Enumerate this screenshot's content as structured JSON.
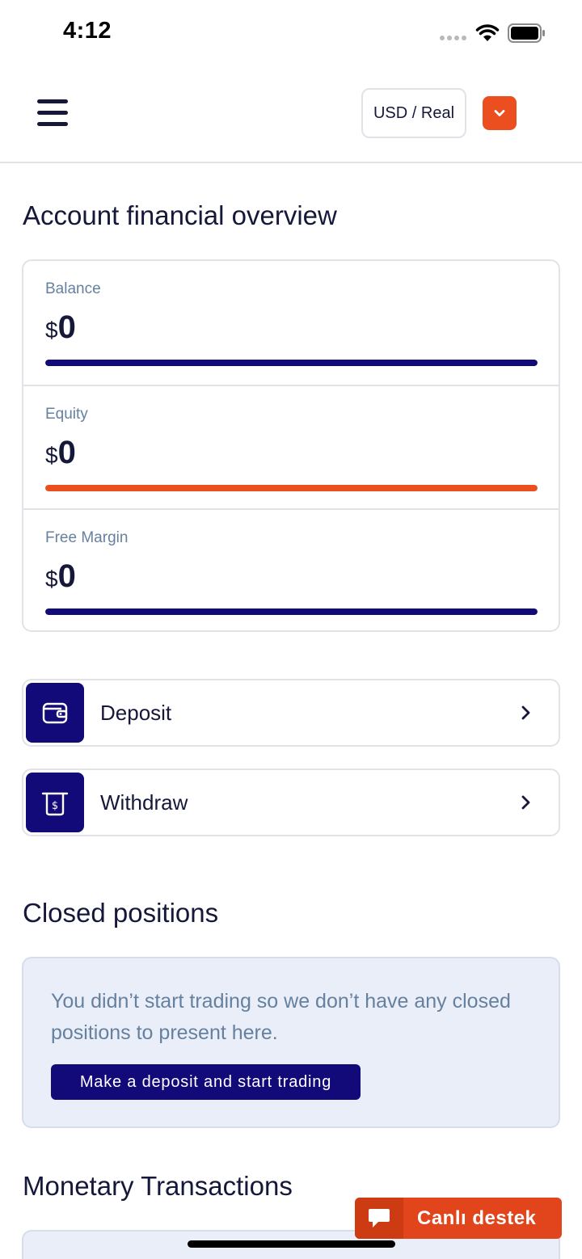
{
  "status_bar": {
    "time": "4:12"
  },
  "header": {
    "account_label": "USD / Real"
  },
  "overview": {
    "title": "Account financial overview",
    "currency_symbol": "$",
    "metrics": [
      {
        "label": "Balance",
        "value": "0",
        "bar_color": "#120a78",
        "fill_fraction": 1.0
      },
      {
        "label": "Equity",
        "value": "0",
        "bar_color": "#eb4f1f",
        "fill_fraction": 1.0
      },
      {
        "label": "Free Margin",
        "value": "0",
        "bar_color": "#120a78",
        "fill_fraction": 1.0
      }
    ]
  },
  "actions": [
    {
      "label": "Deposit",
      "icon": "wallet-icon"
    },
    {
      "label": "Withdraw",
      "icon": "cash-withdraw-icon"
    }
  ],
  "closed_positions": {
    "title": "Closed positions",
    "empty_message": "You didn’t start trading so we don’t have any closed positions to present here.",
    "cta_label": "Make a deposit and start trading"
  },
  "monetary_transactions": {
    "title": "Monetary Transactions"
  },
  "support": {
    "label": "Canlı destek",
    "icon": "chat-bubble-icon"
  },
  "colors": {
    "brand_navy": "#120a78",
    "accent_orange": "#eb4f1f",
    "muted_text": "#6680a0"
  }
}
